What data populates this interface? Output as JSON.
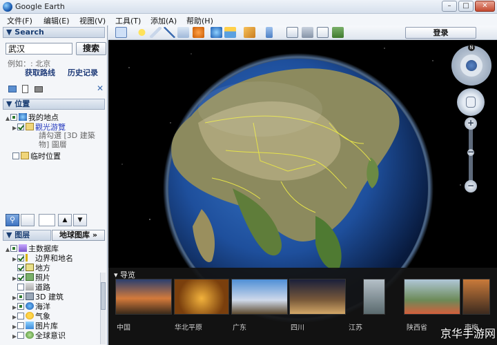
{
  "window": {
    "title": "Google Earth",
    "min": "–",
    "max": "□",
    "close": "✕"
  },
  "menu": [
    "文件(F)",
    "编辑(E)",
    "视图(V)",
    "工具(T)",
    "添加(A)",
    "帮助(H)"
  ],
  "toolbar": {
    "login_label": "登录"
  },
  "search": {
    "header": "Search",
    "input_value": "武汉",
    "button_label": "搜索",
    "hint": "例如：: 北京",
    "directions_link": "获取路线",
    "history_link": "历史记录"
  },
  "places": {
    "header": "位置",
    "items": [
      {
        "label": "我的地点",
        "checked": "part"
      },
      {
        "label": "觀光游覽",
        "checked": "on"
      },
      {
        "label": "請勾選 [3D 建築物] 圖層",
        "checked": "none"
      },
      {
        "label": "临时位置",
        "checked": "off"
      }
    ]
  },
  "layers": {
    "header": "图层",
    "gallery_button": "地球图库 »",
    "items": [
      {
        "label": "主数据库",
        "state": "part"
      },
      {
        "label": "边界和地名",
        "state": "on"
      },
      {
        "label": "地方",
        "state": "on"
      },
      {
        "label": "照片",
        "state": "on"
      },
      {
        "label": "道路",
        "state": "off"
      },
      {
        "label": "3D 建筑",
        "state": "part"
      },
      {
        "label": "海洋",
        "state": "part"
      },
      {
        "label": "气象",
        "state": "off"
      },
      {
        "label": "图片库",
        "state": "off"
      },
      {
        "label": "全球意识",
        "state": "off"
      }
    ]
  },
  "tour": {
    "title": "导览",
    "items": [
      "中国",
      "华北平原",
      "广东",
      "四川",
      "江苏",
      "陕西省",
      "南梅"
    ]
  },
  "watermark": "京华手游网",
  "colors": {
    "link": "#213d7a",
    "panel_header": "#1a3e73",
    "border": "#9eadc2"
  }
}
